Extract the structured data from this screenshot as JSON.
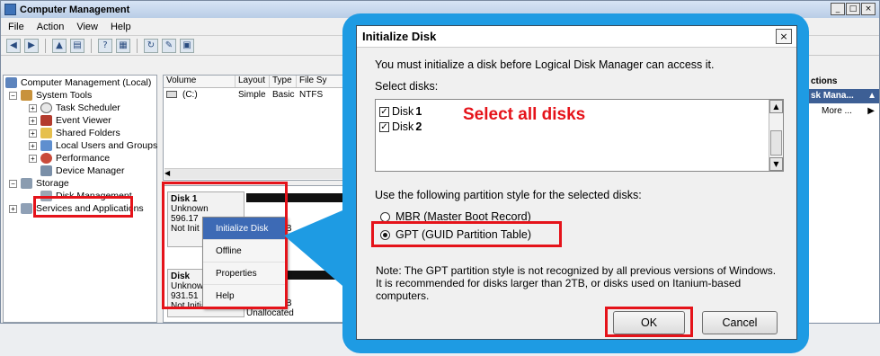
{
  "window": {
    "title": "Computer Management",
    "menu": [
      "File",
      "Action",
      "View",
      "Help"
    ]
  },
  "tree": {
    "items": [
      {
        "label": "Computer Management (Local)",
        "icon": "computer-icon"
      },
      {
        "label": "System Tools",
        "icon": "tools-icon"
      },
      {
        "label": "Task Scheduler",
        "icon": "clock-icon"
      },
      {
        "label": "Event Viewer",
        "icon": "event-viewer-icon"
      },
      {
        "label": "Shared Folders",
        "icon": "shared-folder-icon"
      },
      {
        "label": "Local Users and Groups",
        "icon": "users-icon"
      },
      {
        "label": "Performance",
        "icon": "performance-icon"
      },
      {
        "label": "Device Manager",
        "icon": "device-manager-icon"
      },
      {
        "label": "Storage",
        "icon": "storage-icon"
      },
      {
        "label": "Disk Management",
        "icon": "disk-icon"
      },
      {
        "label": "Services and Applications",
        "icon": "services-icon"
      }
    ]
  },
  "volumes": {
    "columns": [
      "Volume",
      "Layout",
      "Type",
      "File Sy"
    ],
    "rows": [
      {
        "volume": "(C:)",
        "layout": "Simple",
        "type": "Basic",
        "fs": "NTFS"
      }
    ]
  },
  "disks": [
    {
      "name": "Disk 1",
      "type": "Unknown",
      "size": "596.17",
      "status": "Not Init",
      "size_suffix": "B"
    },
    {
      "name": "Disk",
      "type": "Unknown",
      "size": "931.51",
      "status": "Not Initialized",
      "size_suffix": "B",
      "partition": "Unallocated"
    }
  ],
  "context_menu": {
    "items": [
      "Initialize Disk",
      "Offline",
      "Properties",
      "Help"
    ]
  },
  "actions": {
    "header": "ctions",
    "section": "sk Mana...",
    "more": "More ..."
  },
  "dialog": {
    "title": "Initialize Disk",
    "message": "You must initialize a disk before Logical Disk Manager can access it.",
    "select_label": "Select disks:",
    "disks": [
      {
        "label": "Disk",
        "num": "1",
        "checked": true
      },
      {
        "label": "Disk",
        "num": "2",
        "checked": true
      }
    ],
    "annotation": "Select all disks",
    "partition_label": "Use the following partition style for the selected disks:",
    "options": [
      {
        "label": "MBR (Master Boot Record)",
        "selected": false
      },
      {
        "label": "GPT (GUID Partition Table)",
        "selected": true
      }
    ],
    "note": "Note: The GPT partition style is not recognized by all previous versions of Windows. It is recommended for disks larger than 2TB, or disks used on Itanium-based computers.",
    "ok": "OK",
    "cancel": "Cancel"
  },
  "colors": {
    "highlight": "#e5131a",
    "frame": "#1e9be3"
  }
}
